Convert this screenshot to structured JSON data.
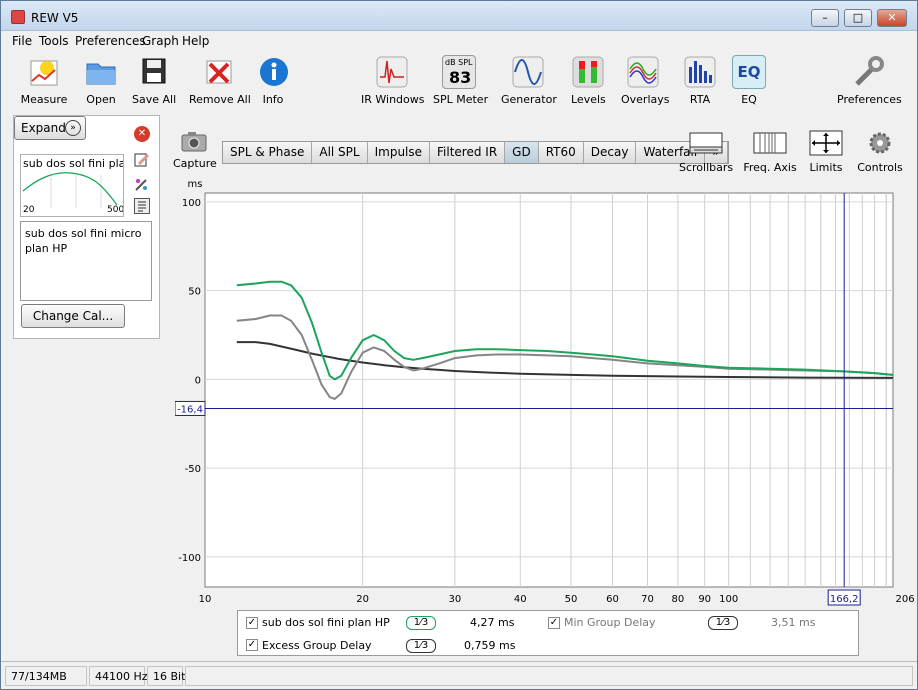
{
  "window": {
    "title": "REW V5",
    "minimize": "–",
    "maximize": "□",
    "close": "✕"
  },
  "menu": [
    "File",
    "Tools",
    "Preferences",
    "Graph",
    "Help"
  ],
  "toolbar": {
    "left": [
      {
        "label": "Measure",
        "icon": "measure-icon"
      },
      {
        "label": "Open",
        "icon": "folder-icon"
      },
      {
        "label": "Save All",
        "icon": "save-icon"
      },
      {
        "label": "Remove All",
        "icon": "remove-icon"
      },
      {
        "label": "Info",
        "icon": "info-icon"
      }
    ],
    "center": [
      {
        "label": "IR Windows",
        "icon": "ir-windows-icon"
      },
      {
        "label": "SPL Meter",
        "icon": "spl-meter-icon",
        "badge_top": "dB SPL",
        "badge_value": "83"
      },
      {
        "label": "Generator",
        "icon": "generator-icon"
      },
      {
        "label": "Levels",
        "icon": "levels-icon"
      },
      {
        "label": "Overlays",
        "icon": "overlays-icon"
      },
      {
        "label": "RTA",
        "icon": "rta-icon"
      },
      {
        "label": "EQ",
        "icon": "eq-icon",
        "badge_value": "EQ"
      }
    ],
    "right": {
      "label": "Preferences",
      "icon": "wrench-icon"
    }
  },
  "left_panel": {
    "expand_label": "Expand",
    "measurement_name": "sub dos sol fini plan",
    "thumb_x_min": "20",
    "thumb_x_max": "500",
    "notes": "sub dos sol fini micro plan HP",
    "change_cal_label": "Change Cal..."
  },
  "capture_label": "Capture",
  "tabs": [
    "SPL & Phase",
    "All SPL",
    "Impulse",
    "Filtered IR",
    "GD",
    "RT60",
    "Decay",
    "Waterfall",
    "»"
  ],
  "active_tab": "GD",
  "right_tools": [
    {
      "label": "Scrollbars",
      "icon": "scrollbars-icon"
    },
    {
      "label": "Freq. Axis",
      "icon": "freq-axis-icon"
    },
    {
      "label": "Limits",
      "icon": "limits-icon"
    },
    {
      "label": "Controls",
      "icon": "gear-icon"
    }
  ],
  "colors": {
    "green": "#1aa55a",
    "gray": "#858585",
    "dark": "#333333",
    "cursor": "#1c1c8f"
  },
  "chart_data": {
    "type": "line",
    "ylabel": "ms",
    "x_scale": "log",
    "xlim": [
      10,
      206
    ],
    "ylim": [
      -117,
      105
    ],
    "x_ticks": [
      10,
      20,
      30,
      40,
      50,
      60,
      70,
      80,
      90,
      100
    ],
    "x_tick_labels": [
      "10",
      "20",
      "30",
      "40",
      "50",
      "60",
      "70",
      "80",
      "90",
      "100"
    ],
    "x_end_label": "206 Hz",
    "y_ticks": [
      100,
      50,
      0,
      -50,
      -100
    ],
    "y_tick_labels": [
      "100",
      "50",
      "0",
      "-50",
      "-100"
    ],
    "cursor": {
      "x": 166.2,
      "y": -16.4,
      "x_label": "166,2",
      "y_label": "-16,4"
    },
    "series": [
      {
        "name": "sub dos sol fini plan HP",
        "color": "#1aa55a",
        "value_label": "4,27 ms",
        "x": [
          11.5,
          12.5,
          13.3,
          14,
          14.6,
          15.3,
          16,
          16.7,
          17.3,
          17.7,
          18.2,
          19.0,
          20.0,
          21.0,
          22.0,
          23.0,
          24.0,
          25.0,
          26.0,
          28.0,
          30.0,
          33.0,
          36.0,
          40.0,
          45.0,
          50.0,
          55.0,
          60.0,
          70.0,
          80.0,
          90.0,
          100.0,
          120.0,
          140.0,
          166.0,
          190.0,
          206.0
        ],
        "y": [
          53,
          54,
          55,
          55,
          53,
          46,
          32,
          15,
          2,
          0,
          2,
          12,
          22,
          25,
          22,
          16,
          12,
          11,
          12,
          14,
          16,
          17,
          17,
          16.5,
          16,
          15,
          14,
          13,
          10.5,
          9,
          7.5,
          6.5,
          6,
          5.5,
          4.5,
          3.5,
          2.5
        ]
      },
      {
        "name": "Min Group Delay",
        "color": "#858585",
        "value_label": "3,51 ms",
        "x": [
          11.5,
          12.5,
          13.3,
          14,
          14.6,
          15.3,
          16,
          16.7,
          17.3,
          17.7,
          18.2,
          19.0,
          20.0,
          21.0,
          22.0,
          23.0,
          24.0,
          25.0,
          26.0,
          28.0,
          30.0,
          33.0,
          36.0,
          40.0,
          45.0,
          50.0,
          55.0,
          60.0,
          70.0,
          80.0,
          90.0,
          100.0,
          120.0,
          140.0,
          166.0,
          190.0,
          206.0
        ],
        "y": [
          33,
          34,
          36,
          36,
          33,
          25,
          11,
          -3,
          -10,
          -11,
          -8,
          4,
          15,
          18,
          16,
          11,
          7,
          5,
          6,
          9,
          12,
          13.5,
          14,
          14,
          13.5,
          13,
          12,
          11,
          9,
          8,
          7,
          6,
          5.5,
          5,
          4.5,
          3.5,
          2.5
        ]
      },
      {
        "name": "Excess Group Delay",
        "color": "#333333",
        "value_label": "0,759 ms",
        "x": [
          11.5,
          12.5,
          13.3,
          14,
          15,
          16,
          17,
          18,
          19,
          20,
          22,
          24,
          26,
          28,
          30,
          35,
          40,
          50,
          60,
          80,
          100,
          140,
          166,
          206
        ],
        "y": [
          21,
          21,
          20,
          18.5,
          16.5,
          14.5,
          13,
          11.5,
          10.5,
          9.5,
          8,
          6.8,
          6,
          5.3,
          4.7,
          3.8,
          3.2,
          2.5,
          2,
          1.6,
          1.3,
          1,
          0.9,
          0.8
        ]
      }
    ]
  },
  "status": [
    "77/134MB",
    "44100 Hz",
    "16 Bit"
  ]
}
